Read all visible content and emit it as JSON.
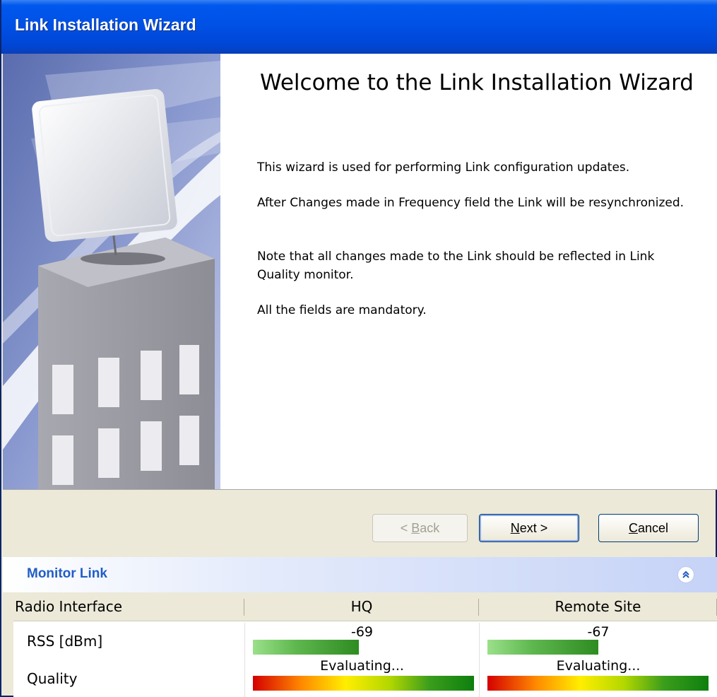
{
  "window": {
    "title": "Link Installation Wizard"
  },
  "welcome": {
    "heading": "Welcome to the Link Installation Wizard",
    "paragraphs": [
      "This wizard is used for performing Link configuration updates.",
      "After Changes made in Frequency field the Link will be resynchronized.",
      "Note that all changes made to the Link should be reflected in Link Quality monitor.",
      "All the fields are mandatory."
    ]
  },
  "buttons": {
    "back": {
      "prefix": "< ",
      "mnemonic": "B",
      "rest": "ack",
      "enabled": false
    },
    "next": {
      "mnemonic": "N",
      "rest": "ext >"
    },
    "cancel": {
      "mnemonic": "C",
      "rest": "ancel"
    }
  },
  "monitor": {
    "title": "Monitor Link",
    "columns": [
      "Radio Interface",
      "HQ",
      "Remote Site"
    ],
    "rows": [
      {
        "label": "RSS [dBm]",
        "hq": "-69",
        "remote": "-67",
        "hq_level": 0.48,
        "remote_level": 0.5
      },
      {
        "label": "Quality",
        "hq": "Evaluating...",
        "remote": "Evaluating...",
        "hq_level": 1.0,
        "remote_level": 1.0
      }
    ]
  },
  "colors": {
    "title_bar": "#0054e3",
    "monitor_title": "#215dc6",
    "rss_bar": "#2e8c21"
  },
  "icons": {
    "collapse": "chevron-double-up-icon"
  }
}
